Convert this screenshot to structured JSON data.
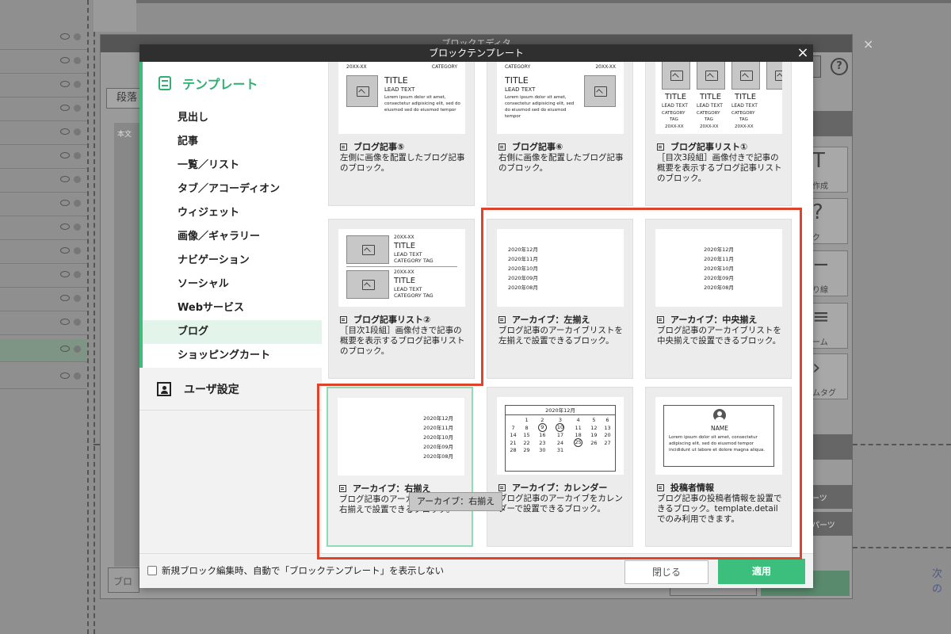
{
  "background": {
    "outer_title": "ブロックエディタ",
    "para_button": "段落",
    "panel_label": "本文",
    "block_input": "ブロ",
    "next_link": "次の",
    "help_icon": "?",
    "right_panel": [
      "作成",
      "ク",
      "り線",
      "ーム",
      "ムタグ",
      "ーツ",
      "パーツ"
    ]
  },
  "modal": {
    "title": "ブロックテンプレート",
    "close_icon": "×"
  },
  "sidebar": {
    "section_title": "テンプレート",
    "items": [
      "見出し",
      "記事",
      "一覧／リスト",
      "タブ／アコーディオン",
      "ウィジェット",
      "画像／ギャラリー",
      "ナビゲーション",
      "ソーシャル",
      "Webサービス",
      "ブログ",
      "ショッピングカート"
    ],
    "active_index": 9,
    "user_settings": "ユーザ設定"
  },
  "cards": [
    {
      "title": "ブログ記事⑤",
      "desc": "左側に画像を配置したブログ記事のブロック。",
      "thumb": {
        "date": "20XX-XX",
        "category": "CATEGORY",
        "heading": "TITLE",
        "lead": "LEAD TEXT",
        "body": "Lorem ipsum dolor sit amet, consectetur adipisicing elit, sed do eiusmod sed do eiusmod tempor"
      }
    },
    {
      "title": "ブログ記事⑥",
      "desc": "右側に画像を配置したブログ記事のブロック。",
      "thumb": {
        "date": "20XX-XX",
        "category": "CATEGORY",
        "heading": "TITLE",
        "lead": "LEAD TEXT",
        "body": "Lorem ipsum dolor sit amet, consectetur adipisicing elit, sed do eiusmod sed do eiusmod tempor"
      }
    },
    {
      "title": "ブログ記事リスト①",
      "desc": "［目次3段組］画像付きで記事の概要を表示するブログ記事リストのブロック。",
      "thumb": {
        "heading": "TITLE",
        "lead": "LEAD TEXT",
        "category": "CATEGORY",
        "tag": "TAG",
        "date": "20XX-XX"
      }
    },
    {
      "title": "ブログ記事リスト②",
      "desc": "［目次1段組］画像付きで記事の概要を表示するブログ記事リストのブロック。",
      "thumb": {
        "date": "20XX-XX",
        "heading": "TITLE",
        "lead": "LEAD TEXT",
        "category_tag": "CATEGORY TAG"
      }
    },
    {
      "title": "アーカイブ：左揃え",
      "desc": "ブログ記事のアーカイブリストを左揃えで設置できるブロック。",
      "thumb": {
        "months": [
          "2020年12月",
          "2020年11月",
          "2020年10月",
          "2020年09月",
          "2020年08月"
        ]
      }
    },
    {
      "title": "アーカイブ：中央揃え",
      "desc": "ブログ記事のアーカイブリストを中央揃えで設置できるブロック。",
      "thumb": {
        "months": [
          "2020年12月",
          "2020年11月",
          "2020年10月",
          "2020年09月",
          "2020年08月"
        ]
      }
    },
    {
      "title": "アーカイブ：右揃え",
      "desc": "ブログ記事のアーカイブリストを右揃えで設置できるブロック。",
      "thumb": {
        "months": [
          "2020年12月",
          "2020年11月",
          "2020年10月",
          "2020年09月",
          "2020年08月"
        ]
      }
    },
    {
      "title": "アーカイブ：カレンダー",
      "desc": "ブログ記事のアーカイブをカレンダーで設置できるブロック。",
      "thumb": {
        "month": "2020年12月",
        "weeks": [
          [
            "1",
            "2",
            "3",
            "4",
            "5",
            "6"
          ],
          [
            "7",
            "8",
            "9",
            "10",
            "11",
            "12",
            "13"
          ],
          [
            "14",
            "15",
            "16",
            "17",
            "18",
            "19",
            "20"
          ],
          [
            "21",
            "22",
            "23",
            "24",
            "25",
            "26",
            "27"
          ],
          [
            "28",
            "29",
            "30",
            "31"
          ]
        ],
        "circled": [
          "9",
          "10",
          "25"
        ]
      }
    },
    {
      "title": "投稿者情報",
      "desc": "ブログ記事の投稿者情報を設置できるブロック。template.detailでのみ利用できます。",
      "thumb": {
        "name": "NAME",
        "body": "Lorem ipsum dolor sit amet, consectetur adipiscing elit, sed do eiusmod tempor incididunt ut labore et dolore magna aliqua."
      }
    }
  ],
  "tooltip": "アーカイブ：右揃え",
  "footer": {
    "checkbox_label": "新規ブロック編集時、自動で「ブロックテンプレート」を表示しない",
    "close_button": "閉じる",
    "apply_button": "適用"
  },
  "colors": {
    "accent_green": "#3cbf7d",
    "highlight_red": "#e0432b",
    "selected_border": "#8fdbb5"
  }
}
